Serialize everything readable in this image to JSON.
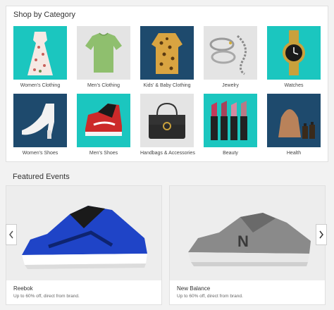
{
  "shop": {
    "title": "Shop by Category",
    "categories": [
      {
        "label": "Women's Clothing",
        "bg": "#1bc6bf"
      },
      {
        "label": "Men's Clothing",
        "bg": "#e4e4e4"
      },
      {
        "label": "Kids' & Baby Clothing",
        "bg": "#1e4a6d"
      },
      {
        "label": "Jewelry",
        "bg": "#e4e4e4"
      },
      {
        "label": "Watches",
        "bg": "#1bc6bf"
      },
      {
        "label": "Women's Shoes",
        "bg": "#1e4a6d"
      },
      {
        "label": "Men's Shoes",
        "bg": "#1bc6bf"
      },
      {
        "label": "Handbags & Accessories",
        "bg": "#e4e4e4"
      },
      {
        "label": "Beauty",
        "bg": "#1bc6bf"
      },
      {
        "label": "Health",
        "bg": "#1e4a6d"
      }
    ]
  },
  "events": {
    "title": "Featured Events",
    "items": [
      {
        "brand": "Reebok",
        "promo": "Up to 60% off, direct from brand."
      },
      {
        "brand": "New Balance",
        "promo": "Up to 60% off, direct from brand."
      }
    ]
  },
  "carousel": {
    "prev_icon": "chevron-left-icon",
    "next_icon": "chevron-right-icon"
  }
}
